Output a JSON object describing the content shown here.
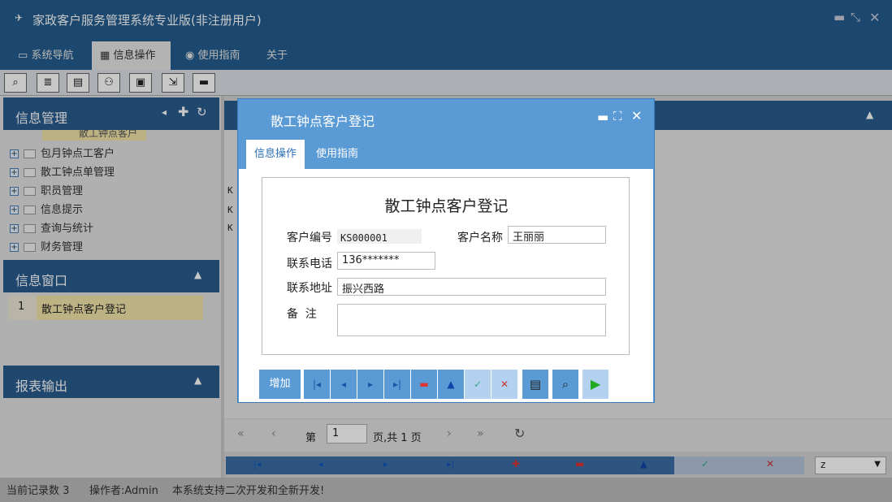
{
  "app": {
    "title": "家政客户服务管理系统专业版(非注册用户)"
  },
  "menu": [
    {
      "label": "系统导航",
      "icon": "monitor-icon"
    },
    {
      "label": "信息操作",
      "icon": "grid-icon"
    },
    {
      "label": "使用指南",
      "icon": "help-icon"
    },
    {
      "label": "关于",
      "icon": ""
    }
  ],
  "sidebar": {
    "info_mgmt_title": "信息管理",
    "tree_top_partial": "散工钟点客户",
    "tree": [
      "包月钟点工客户",
      "散工钟点单管理",
      "职员管理",
      "信息提示",
      "查询与统计",
      "财务管理"
    ],
    "info_window_title": "信息窗口",
    "window_list": [
      {
        "num": "1",
        "label": "散工钟点客户登记"
      }
    ],
    "report_title": "报表输出"
  },
  "grid": {
    "rows_partial": [
      "K",
      "K",
      "K"
    ],
    "pager": {
      "page_label": "第",
      "page_value": "1",
      "page_suffix": "页,共 1 页"
    },
    "select_value": "z"
  },
  "status": {
    "record_count": "当前记录数 3",
    "operator": "操作者:Admin",
    "message": "本系统支持二次开发和全新开发!"
  },
  "dialog": {
    "title": "散工钟点客户登记",
    "tabs": [
      "信息操作",
      "使用指南"
    ],
    "form_title": "散工钟点客户登记",
    "fields": {
      "code_label": "客户编号",
      "code_value": "KS000001",
      "name_label": "客户名称",
      "name_value": "王丽丽",
      "phone_label": "联系电话",
      "phone_value": "136*******",
      "address_label": "联系地址",
      "address_value": "振兴西路",
      "note_label": "备  注",
      "note_value": ""
    },
    "buttons": {
      "add": "增加"
    }
  }
}
